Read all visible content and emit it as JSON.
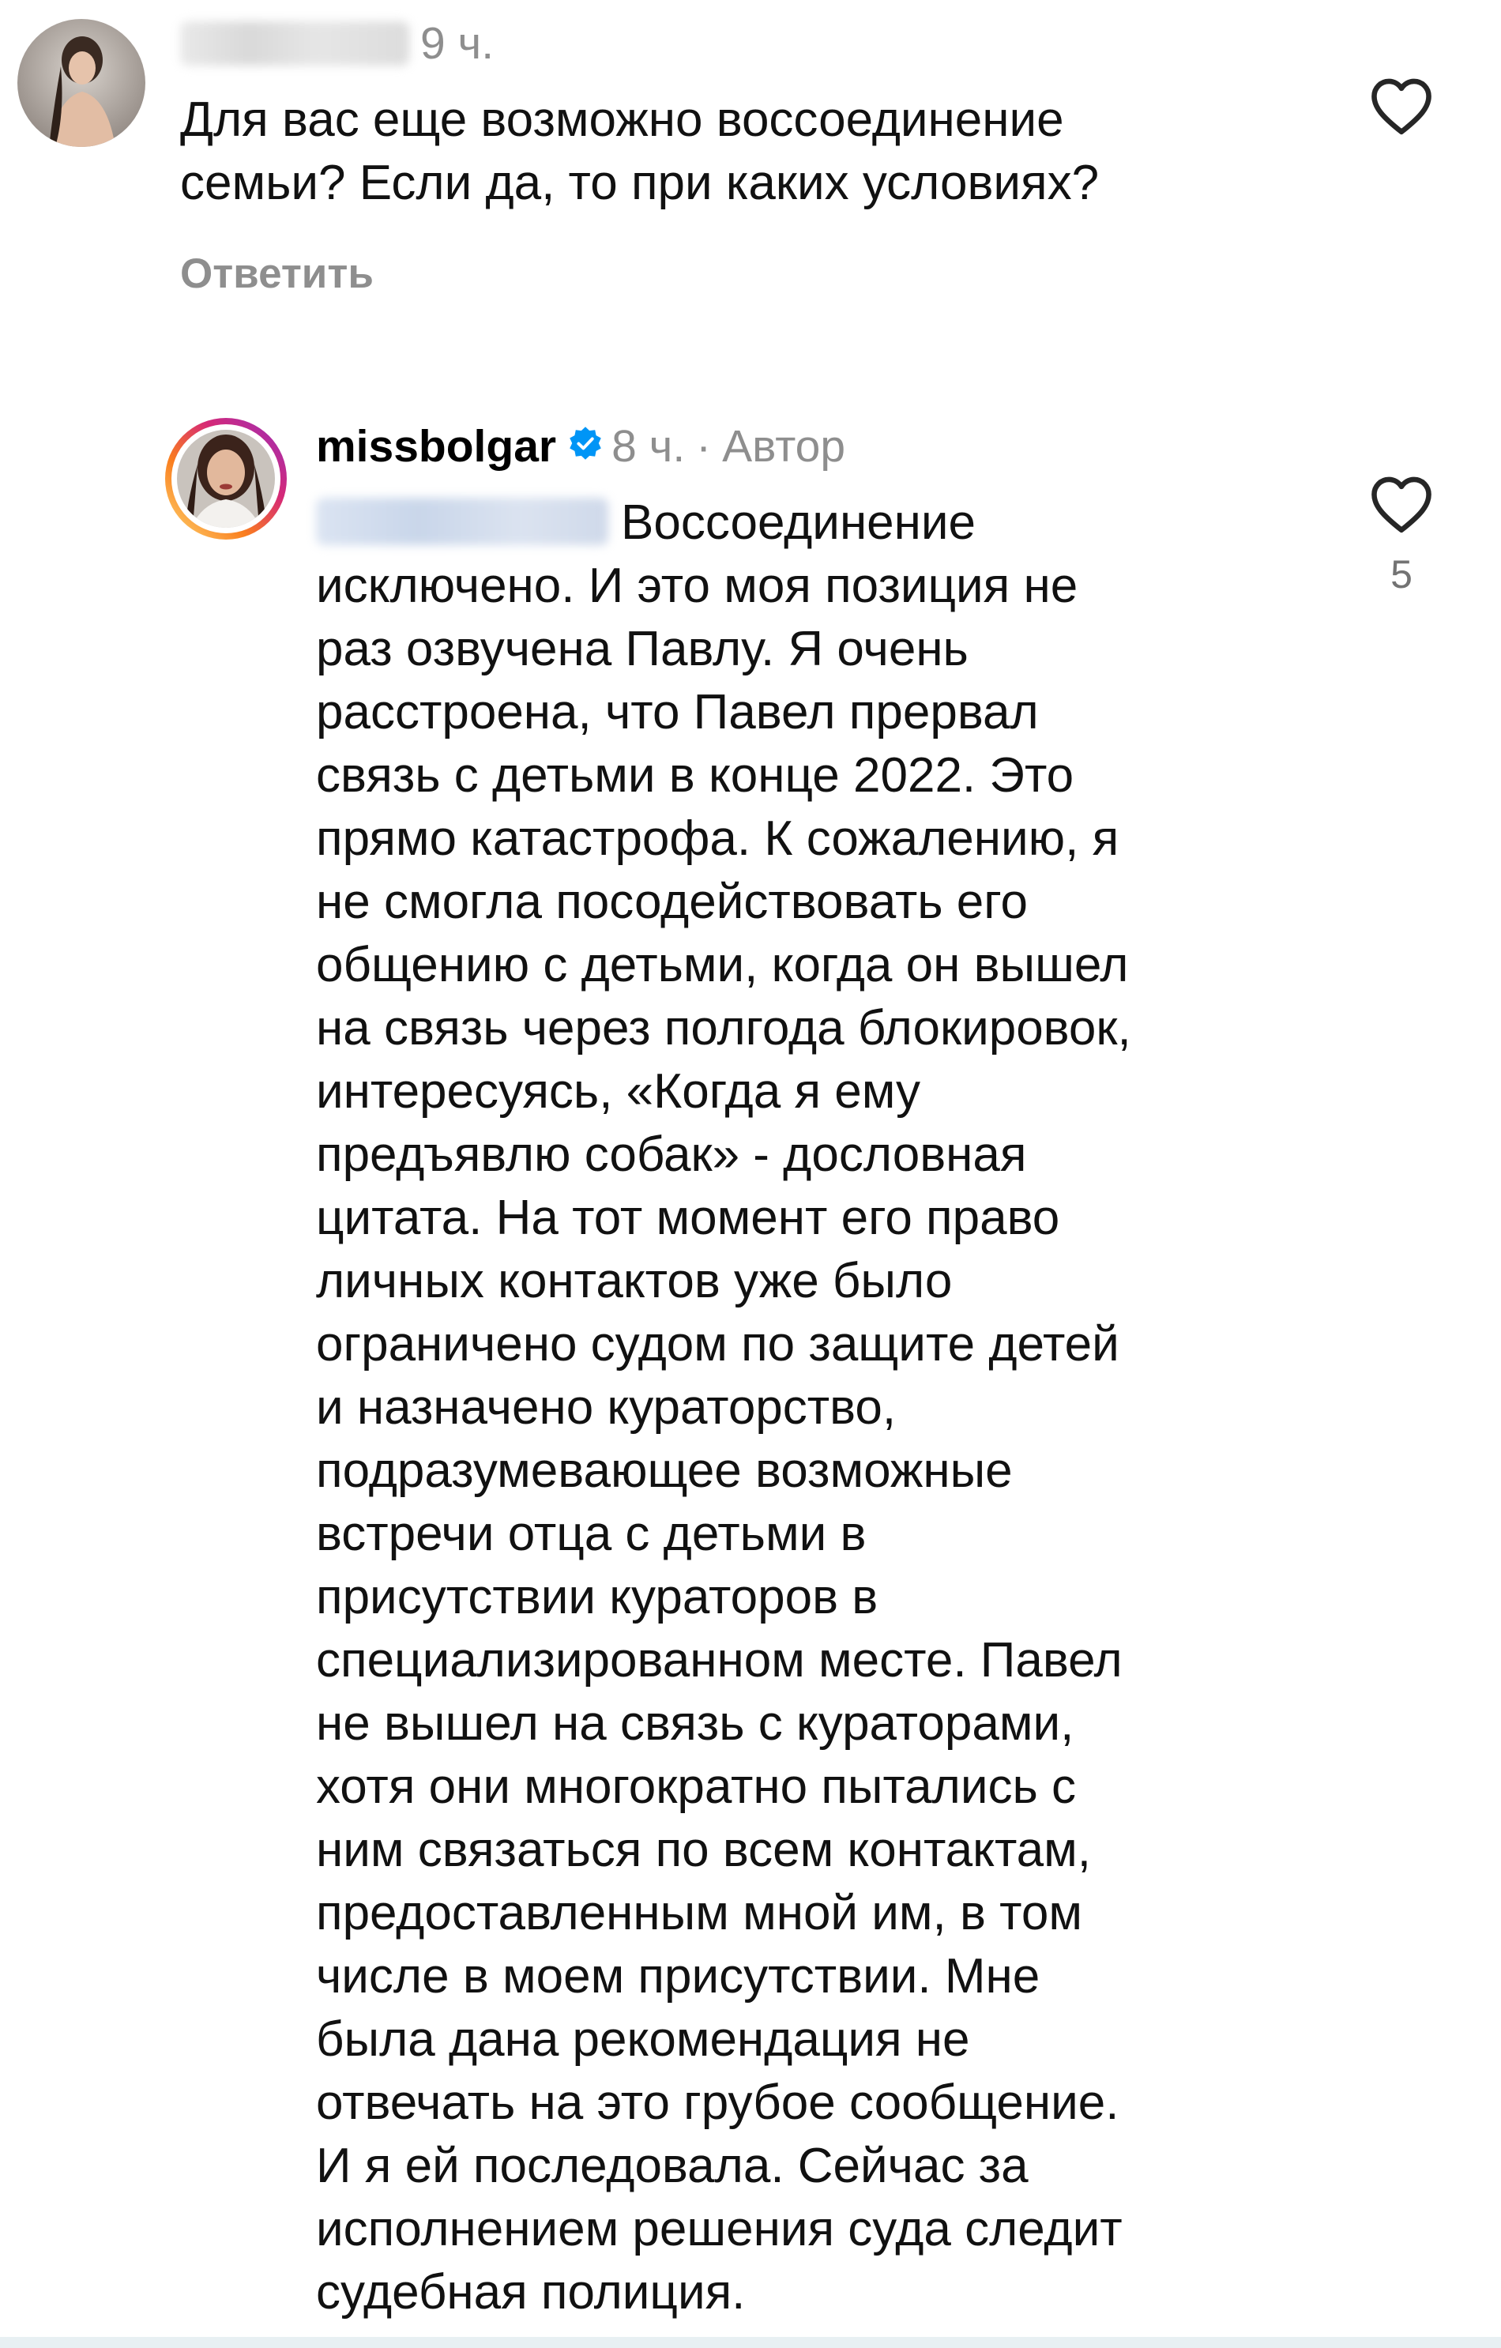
{
  "comments": [
    {
      "username": "",
      "username_redacted": true,
      "time": "9 ч.",
      "text_lines": [
        "Для вас еще возможно воссоединение",
        "семьи? Если да, то при каких условиях?"
      ],
      "reply_label": "Ответить",
      "like_icon": "heart-outline-icon"
    },
    {
      "username": "missbolgar",
      "verified": true,
      "time": "8 ч.",
      "separator": "·",
      "author_badge": "Автор",
      "mention_redacted": true,
      "text_lines": [
        "Воссоединение",
        "исключено. И это моя позиция не",
        "раз озвучена Павлу. Я очень",
        "расстроена, что Павел прервал",
        "связь с детьми в конце 2022. Это",
        "прямо катастрофа. К сожалению, я",
        "не смогла посодействовать его",
        "общению с детьми, когда он вышел",
        "на связь через полгода блокировок,",
        "интересуясь, «Когда я ему",
        "предъявлю собак» - дословная",
        "цитата. На тот момент его право",
        "личных контактов уже было",
        "ограничено судом по защите детей",
        "и назначено кураторство,",
        "подразумевающее возможные",
        "встречи отца с детьми в",
        "присутствии кураторов в",
        "специализированном месте. Павел",
        "не вышел на связь с кураторами,",
        "хотя они многократно пытались с",
        "ним связаться по всем контактам,",
        "предоставленным мной им, в том",
        "числе в моем присутствии. Мне",
        "была дана рекомендация не",
        "отвечать на это грубое сообщение.",
        "И я ей последовала. Сейчас за",
        "исполнением решения суда следит",
        "судебная полиция."
      ],
      "like_icon": "heart-outline-icon",
      "like_count": "5"
    }
  ],
  "colors": {
    "secondary_text": "#8e8e8e",
    "verified_blue": "#0095f6",
    "story_ring_start": "#feda75",
    "story_ring_mid": "#d62976",
    "story_ring_end": "#962fbf"
  }
}
